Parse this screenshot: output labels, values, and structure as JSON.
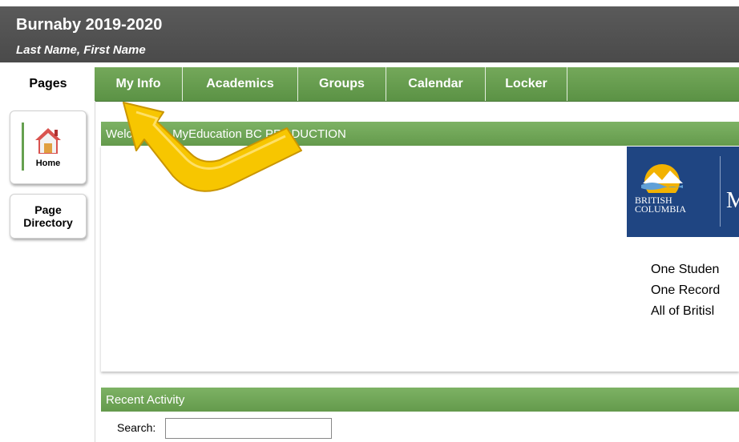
{
  "header": {
    "organization": "Burnaby 2019-2020",
    "user_name": "Last Name, First Name"
  },
  "tabs": {
    "pages_label": "Pages",
    "items": [
      {
        "label": "My Info"
      },
      {
        "label": "Academics"
      },
      {
        "label": "Groups"
      },
      {
        "label": "Calendar"
      },
      {
        "label": "Locker"
      }
    ]
  },
  "sidebar": {
    "home_label": "Home",
    "directory_label_line1": "Page",
    "directory_label_line2": "Directory"
  },
  "welcome": {
    "title": "Welcome to MyEducation BC PRODUCTION",
    "logo_line1": "BRITISH",
    "logo_line2": "COLUMBIA",
    "logo_partial": "M",
    "tagline_lines": [
      "One Studen",
      "One Record",
      "All of Britisl"
    ]
  },
  "recent_activity": {
    "title": "Recent Activity",
    "search_label": "Search:",
    "search_value": ""
  },
  "colors": {
    "header_bg": "#4e4e4e",
    "tab_green": "#649a4c",
    "bc_blue": "#1f4582",
    "arrow_yellow": "#f7c600"
  }
}
